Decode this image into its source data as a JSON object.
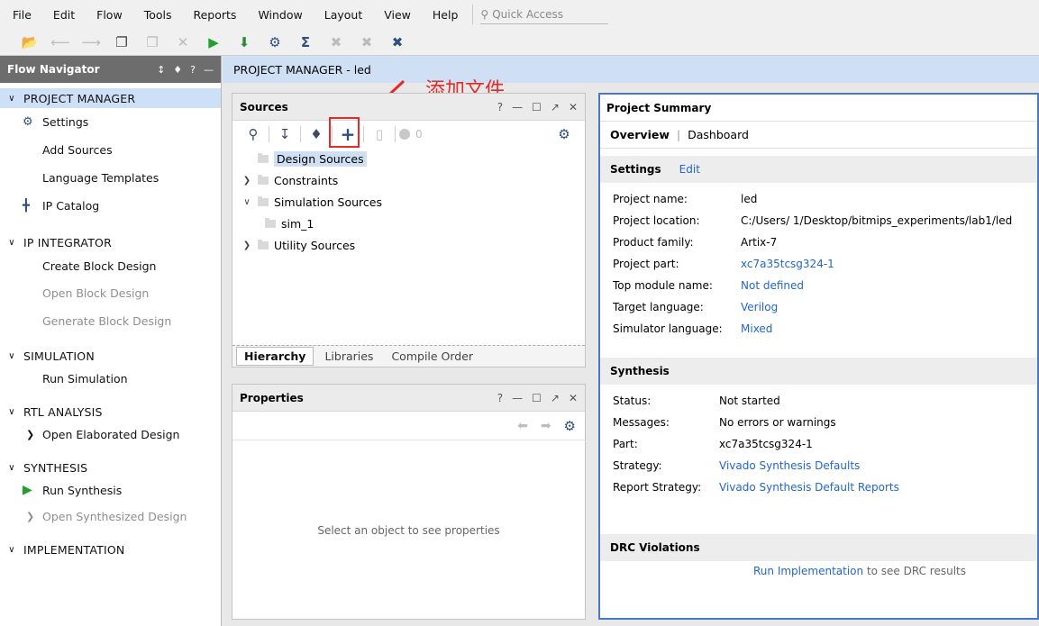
{
  "menu": [
    "File",
    "Edit",
    "Flow",
    "Tools",
    "Reports",
    "Window",
    "Layout",
    "View",
    "Help"
  ],
  "quick_access": {
    "placeholder": "Quick Access"
  },
  "flow_navigator": {
    "title": "Flow Navigator",
    "sections": [
      {
        "label": "PROJECT MANAGER",
        "items": [
          {
            "label": "Settings",
            "icon": "gear-icon",
            "disabled": false
          },
          {
            "label": "Add Sources",
            "disabled": false
          },
          {
            "label": "Language Templates",
            "disabled": false
          },
          {
            "label": "IP Catalog",
            "icon": "ip-icon",
            "disabled": false
          }
        ]
      },
      {
        "label": "IP INTEGRATOR",
        "items": [
          {
            "label": "Create Block Design",
            "disabled": false
          },
          {
            "label": "Open Block Design",
            "disabled": true
          },
          {
            "label": "Generate Block Design",
            "disabled": true
          }
        ]
      },
      {
        "label": "SIMULATION",
        "items": [
          {
            "label": "Run Simulation",
            "disabled": false
          }
        ]
      },
      {
        "label": "RTL ANALYSIS",
        "items": [
          {
            "label": "Open Elaborated Design",
            "disabled": false
          }
        ]
      },
      {
        "label": "SYNTHESIS",
        "items": [
          {
            "label": "Run Synthesis",
            "disabled": false
          },
          {
            "label": "Open Synthesized Design",
            "disabled": true
          }
        ]
      },
      {
        "label": "IMPLEMENTATION",
        "items": []
      }
    ]
  },
  "header": {
    "title": "PROJECT MANAGER - led"
  },
  "sources": {
    "title": "Sources",
    "count": "0",
    "tree": [
      "Design Sources",
      "Constraints",
      "Simulation Sources",
      "sim_1",
      "Utility Sources"
    ],
    "tabs": [
      "Hierarchy",
      "Libraries",
      "Compile Order"
    ]
  },
  "properties": {
    "title": "Properties",
    "empty": "Select an object to see properties"
  },
  "annotation": {
    "text": "添加文件"
  },
  "summary": {
    "title": "Project Summary",
    "tabs": [
      "Overview",
      "Dashboard"
    ],
    "settings": {
      "title": "Settings",
      "edit": "Edit",
      "rows": [
        {
          "k": "Project name:",
          "v": "led",
          "link": false
        },
        {
          "k": "Project location:",
          "v": "C:/Users/        1/Desktop/bitmips_experiments/lab1/led",
          "link": false
        },
        {
          "k": "Product family:",
          "v": "Artix-7",
          "link": false
        },
        {
          "k": "Project part:",
          "v": "xc7a35tcsg324-1",
          "link": true
        },
        {
          "k": "Top module name:",
          "v": "Not defined",
          "link": true
        },
        {
          "k": "Target language:",
          "v": "Verilog",
          "link": true
        },
        {
          "k": "Simulator language:",
          "v": "Mixed",
          "link": true
        }
      ]
    },
    "synthesis": {
      "title": "Synthesis",
      "rows": [
        {
          "k": "Status:",
          "v": "Not started",
          "link": false
        },
        {
          "k": "Messages:",
          "v": "No errors or warnings",
          "link": false
        },
        {
          "k": "Part:",
          "v": "xc7a35tcsg324-1",
          "link": false
        },
        {
          "k": "Strategy:",
          "v": "Vivado Synthesis Defaults",
          "link": true
        },
        {
          "k": "Report Strategy:",
          "v": "Vivado Synthesis Default Reports",
          "link": true
        }
      ]
    },
    "drc": {
      "title": "DRC Violations",
      "link": "Run Implementation",
      "tail": "to see DRC results"
    }
  }
}
